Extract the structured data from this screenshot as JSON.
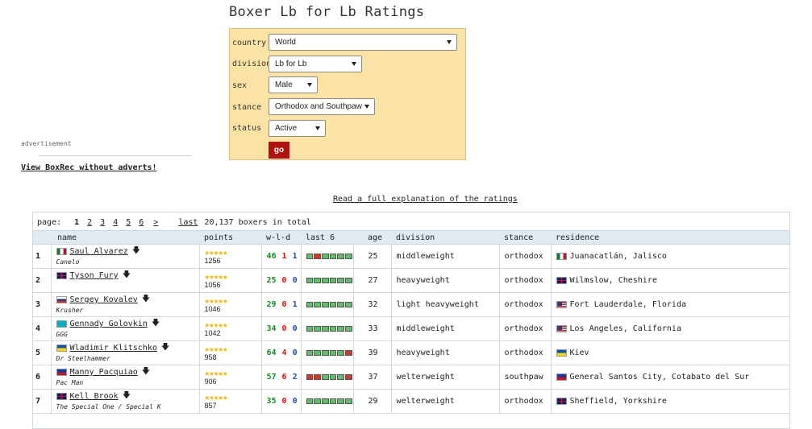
{
  "page_title": "Boxer Lb for Lb Ratings",
  "form": {
    "country_label": "country",
    "country_value": "World",
    "division_label": "division",
    "division_value": "Lb for Lb",
    "sex_label": "sex",
    "sex_value": "Male",
    "stance_label": "stance",
    "stance_value": "Orthodox and Southpaw",
    "status_label": "status",
    "status_value": "Active",
    "go_label": "go"
  },
  "ad": {
    "label": "advertisement",
    "no_adverts_link": "View BoxRec without adverts!"
  },
  "explain_link": "Read a full explanation of the ratings",
  "pager": {
    "label": "page:",
    "pages": [
      "1",
      "2",
      "3",
      "4",
      "5",
      "6"
    ],
    "current": "1",
    "next": ">",
    "last": "last",
    "total": "20,137 boxers in total"
  },
  "columns": [
    "name",
    "points",
    "w-l-d",
    "last 6",
    "age",
    "division",
    "stance",
    "residence"
  ],
  "rows": [
    {
      "rank": "1",
      "flag": "mx",
      "name": "Saul Alvarez",
      "alias": "Canelo",
      "stars": "★★★★★",
      "points": "1256",
      "w": "46",
      "l": "1",
      "d": "1",
      "last6": [
        "win",
        "loss",
        "win",
        "win",
        "win",
        "win"
      ],
      "age": "25",
      "division": "middleweight",
      "stance": "orthodox",
      "res_flag": "mx",
      "residence": "Juanacatlán, Jalisco"
    },
    {
      "rank": "2",
      "flag": "gb",
      "name": "Tyson Fury",
      "alias": "",
      "stars": "★★★★★",
      "points": "1056",
      "w": "25",
      "l": "0",
      "d": "0",
      "last6": [
        "win",
        "win",
        "win",
        "win",
        "win",
        "win"
      ],
      "age": "27",
      "division": "heavyweight",
      "stance": "orthodox",
      "res_flag": "gb",
      "residence": "Wilmslow, Cheshire"
    },
    {
      "rank": "3",
      "flag": "ru",
      "name": "Sergey Kovalev",
      "alias": "Krusher",
      "stars": "★★★★★",
      "points": "1046",
      "w": "29",
      "l": "0",
      "d": "1",
      "last6": [
        "win",
        "win",
        "win",
        "win",
        "win",
        "win"
      ],
      "age": "32",
      "division": "light heavyweight",
      "stance": "orthodox",
      "res_flag": "us",
      "residence": "Fort Lauderdale, Florida"
    },
    {
      "rank": "4",
      "flag": "kz",
      "name": "Gennady Golovkin",
      "alias": "GGG",
      "stars": "★★★★★",
      "points": "1042",
      "w": "34",
      "l": "0",
      "d": "0",
      "last6": [
        "win",
        "win",
        "win",
        "win",
        "win",
        "win"
      ],
      "age": "33",
      "division": "middleweight",
      "stance": "orthodox",
      "res_flag": "us",
      "residence": "Los Angeles, California"
    },
    {
      "rank": "5",
      "flag": "ua",
      "name": "Wladimir Klitschko",
      "alias": "Dr Steelhammer",
      "stars": "★★★★★",
      "points": "958",
      "w": "64",
      "l": "4",
      "d": "0",
      "last6": [
        "win",
        "win",
        "win",
        "win",
        "win",
        "loss"
      ],
      "age": "39",
      "division": "heavyweight",
      "stance": "orthodox",
      "res_flag": "ua",
      "residence": "Kiev"
    },
    {
      "rank": "6",
      "flag": "ph",
      "name": "Manny Pacquiao",
      "alias": "Pac Man",
      "stars": "★★★★★",
      "points": "906",
      "w": "57",
      "l": "6",
      "d": "2",
      "last6": [
        "loss",
        "loss",
        "win",
        "win",
        "win",
        "loss"
      ],
      "age": "37",
      "division": "welterweight",
      "stance": "southpaw",
      "res_flag": "ph",
      "residence": "General Santos City, Cotabato del Sur"
    },
    {
      "rank": "7",
      "flag": "gb",
      "name": "Kell Brook",
      "alias": "The Special One / Special K",
      "stars": "★★★★★",
      "points": "857",
      "w": "35",
      "l": "0",
      "d": "0",
      "last6": [
        "win",
        "win",
        "win",
        "win",
        "win",
        "win"
      ],
      "age": "29",
      "division": "welterweight",
      "stance": "orthodox",
      "res_flag": "gb",
      "residence": "Sheffield, Yorkshire"
    }
  ]
}
